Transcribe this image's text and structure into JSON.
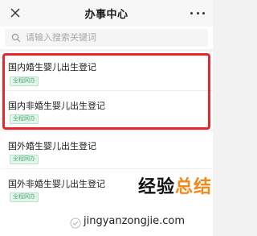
{
  "nav": {
    "title": "办事中心",
    "close_icon": "close-icon",
    "more_icon": "more-dots-icon"
  },
  "search": {
    "placeholder": "请输入搜索关键词",
    "icon": "search-icon"
  },
  "items": [
    {
      "title": "国内婚生婴儿出生登记",
      "tag": "全程网办"
    },
    {
      "title": "国内非婚生婴儿出生登记",
      "tag": "全程网办"
    },
    {
      "title": "国外婚生婴儿出生登记",
      "tag": "全程网办"
    },
    {
      "title": "国外非婚生婴儿出生登记",
      "tag": "全程网办"
    }
  ],
  "watermark": {
    "brand_main": "经验",
    "brand_accent": "总结",
    "url": "jingyanzongjie.com"
  },
  "colors": {
    "highlight": "#e8262b",
    "tag_green": "#4cae79",
    "brand_orange": "#f08a1c"
  }
}
